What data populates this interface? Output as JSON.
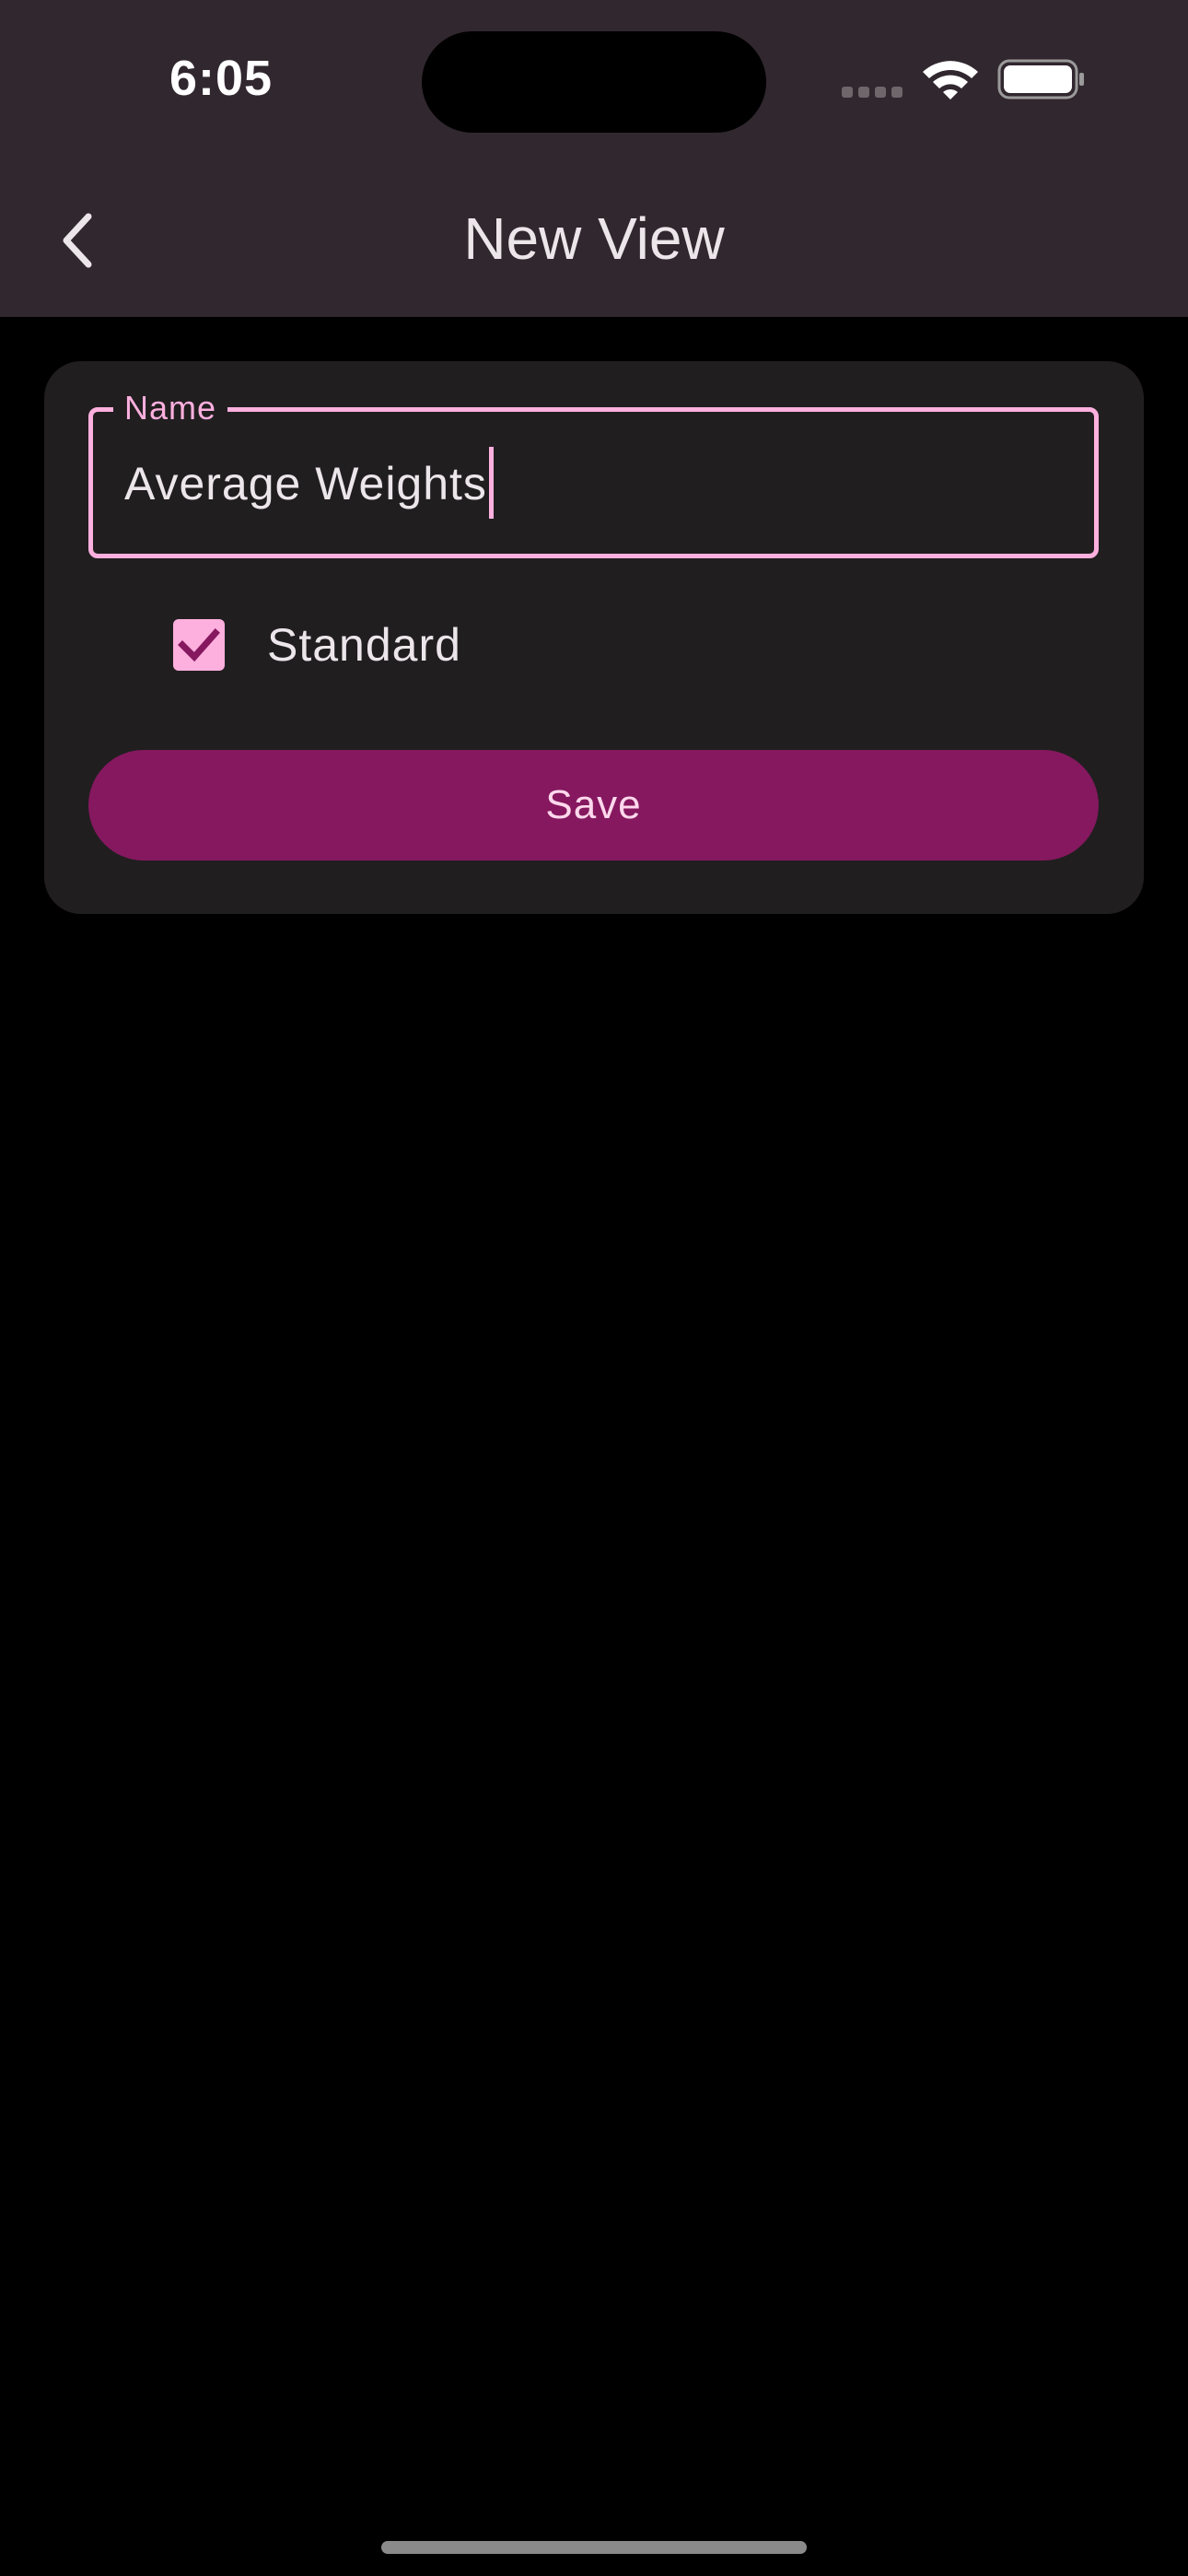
{
  "status_bar": {
    "time": "6:05",
    "signal_icon": "cellular-signal-icon",
    "wifi_icon": "wifi-icon",
    "battery_icon": "battery-icon"
  },
  "app_bar": {
    "back_icon": "chevron-left-icon",
    "title": "New View"
  },
  "form": {
    "name_field": {
      "label": "Name",
      "value": "Average Weights"
    },
    "standard_checkbox": {
      "label": "Standard",
      "checked": true,
      "check_icon": "checkmark-icon"
    },
    "save_label": "Save"
  },
  "colors": {
    "app_bar_background": "#31272E",
    "card_background": "#211E20",
    "accent_pink": "#FDB0DE",
    "save_button": "#85185F",
    "checkmark": "#85185F",
    "page_background": "#000000"
  }
}
